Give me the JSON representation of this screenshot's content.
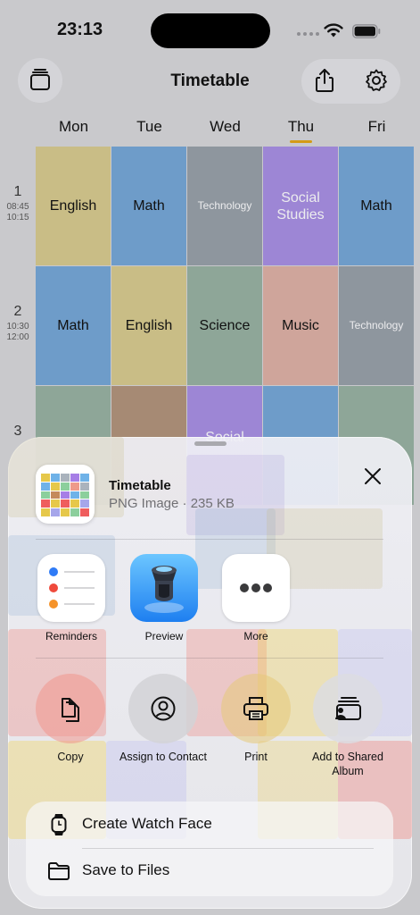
{
  "status_bar": {
    "time": "23:13"
  },
  "header": {
    "title": "Timetable"
  },
  "days": [
    "Mon",
    "Tue",
    "Wed",
    "Thu",
    "Fri"
  ],
  "active_day": "Thu",
  "periods": [
    {
      "num": "1",
      "start": "08:45",
      "end": "10:15"
    },
    {
      "num": "2",
      "start": "10:30",
      "end": "12:00"
    },
    {
      "num": "3",
      "start": "",
      "end": ""
    }
  ],
  "rows": [
    [
      "English",
      "Math",
      "Technology",
      "Social Studies",
      "Math"
    ],
    [
      "Math",
      "English",
      "Science",
      "Music",
      "Technology"
    ],
    [
      "",
      "",
      "Social",
      "",
      ""
    ]
  ],
  "share_sheet": {
    "file_name": "Timetable",
    "file_meta": "PNG Image · 235 KB",
    "apps": [
      {
        "label": "Reminders",
        "icon": "reminders-icon"
      },
      {
        "label": "Preview",
        "icon": "preview-icon"
      },
      {
        "label": "More",
        "icon": "more-icon"
      }
    ],
    "actions": [
      {
        "label": "Copy",
        "icon": "copy-icon"
      },
      {
        "label": "Assign to Contact",
        "icon": "contact-icon"
      },
      {
        "label": "Print",
        "icon": "printer-icon"
      },
      {
        "label": "Add to Shared Album",
        "icon": "shared-album-icon"
      }
    ],
    "list": [
      {
        "label": "Create Watch Face",
        "icon": "watch-icon"
      },
      {
        "label": "Save to Files",
        "icon": "folder-icon"
      }
    ]
  },
  "colors": {
    "accent": "#d49b16",
    "english": "#c9bd86",
    "math": "#6e9cc9",
    "technology": "#8e969e",
    "social_studies": "#9d86d5",
    "science": "#8ea698",
    "music": "#cfa59b",
    "sheet_bg": "#efeff4"
  }
}
